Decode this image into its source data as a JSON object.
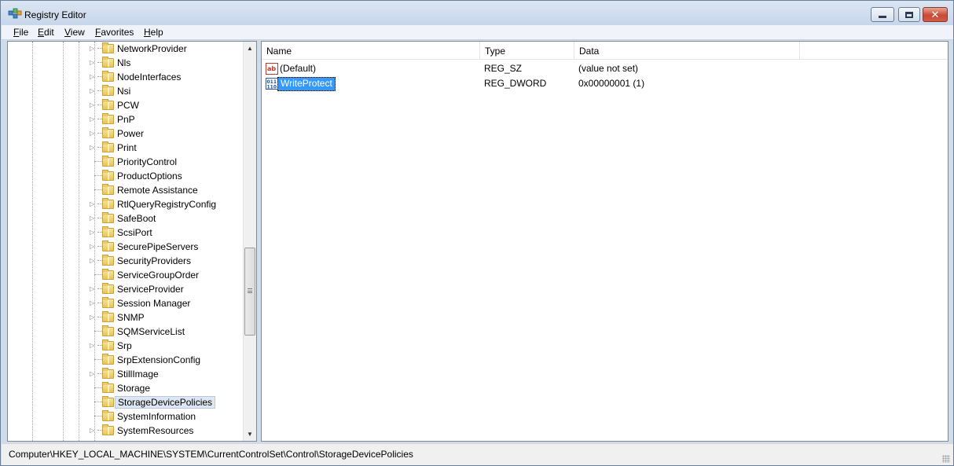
{
  "window": {
    "title": "Registry Editor"
  },
  "menu": [
    "File",
    "Edit",
    "View",
    "Favorites",
    "Help"
  ],
  "tree": {
    "items": [
      {
        "label": "NetworkProvider",
        "expandable": true
      },
      {
        "label": "Nls",
        "expandable": true
      },
      {
        "label": "NodeInterfaces",
        "expandable": true
      },
      {
        "label": "Nsi",
        "expandable": true
      },
      {
        "label": "PCW",
        "expandable": true
      },
      {
        "label": "PnP",
        "expandable": true
      },
      {
        "label": "Power",
        "expandable": true
      },
      {
        "label": "Print",
        "expandable": true
      },
      {
        "label": "PriorityControl",
        "expandable": false
      },
      {
        "label": "ProductOptions",
        "expandable": false
      },
      {
        "label": "Remote Assistance",
        "expandable": false
      },
      {
        "label": "RtlQueryRegistryConfig",
        "expandable": true
      },
      {
        "label": "SafeBoot",
        "expandable": true
      },
      {
        "label": "ScsiPort",
        "expandable": true
      },
      {
        "label": "SecurePipeServers",
        "expandable": true
      },
      {
        "label": "SecurityProviders",
        "expandable": true
      },
      {
        "label": "ServiceGroupOrder",
        "expandable": false
      },
      {
        "label": "ServiceProvider",
        "expandable": true
      },
      {
        "label": "Session Manager",
        "expandable": true
      },
      {
        "label": "SNMP",
        "expandable": true
      },
      {
        "label": "SQMServiceList",
        "expandable": false
      },
      {
        "label": "Srp",
        "expandable": true
      },
      {
        "label": "SrpExtensionConfig",
        "expandable": false
      },
      {
        "label": "StillImage",
        "expandable": true
      },
      {
        "label": "Storage",
        "expandable": false
      },
      {
        "label": "StorageDevicePolicies",
        "expandable": false,
        "selected": true
      },
      {
        "label": "SystemInformation",
        "expandable": false
      },
      {
        "label": "SystemResources",
        "expandable": true
      }
    ]
  },
  "list": {
    "columns": {
      "name": "Name",
      "type": "Type",
      "data": "Data"
    },
    "rows": [
      {
        "name": "(Default)",
        "type": "REG_SZ",
        "data": "(value not set)",
        "icon": "string-value-icon"
      },
      {
        "name": "WriteProtect",
        "type": "REG_DWORD",
        "data": "0x00000001 (1)",
        "icon": "binary-value-icon",
        "selected": true
      }
    ]
  },
  "status": {
    "path": "Computer\\HKEY_LOCAL_MACHINE\\SYSTEM\\CurrentControlSet\\Control\\StorageDevicePolicies"
  },
  "colors": {
    "selection": "#3399ff",
    "title_bar": "#c7d6ea",
    "close_button": "#c84a36",
    "folder": "#e6c35a"
  }
}
